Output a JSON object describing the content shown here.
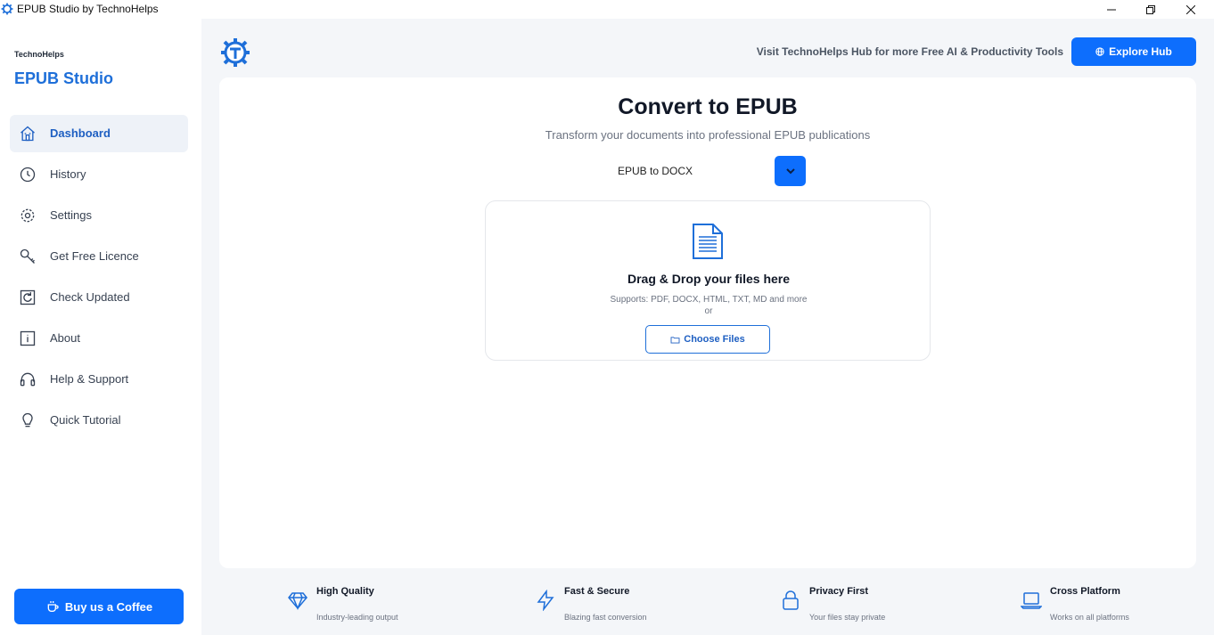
{
  "window": {
    "title": "EPUB Studio by TechnoHelps",
    "colors": {
      "accent": "#0d6efd",
      "brand_text": "#1e6fd9"
    }
  },
  "sidebar": {
    "brand_small": "TechnoHelps",
    "brand_big": "EPUB Studio",
    "items": [
      {
        "label": "Dashboard",
        "icon": "home-icon",
        "active": true
      },
      {
        "label": "History",
        "icon": "clock-icon"
      },
      {
        "label": "Settings",
        "icon": "gear-icon"
      },
      {
        "label": "Get Free Licence",
        "icon": "key-icon"
      },
      {
        "label": "Check Updated",
        "icon": "refresh-icon"
      },
      {
        "label": "About",
        "icon": "info-icon"
      },
      {
        "label": "Help & Support",
        "icon": "headset-icon"
      },
      {
        "label": "Quick Tutorial",
        "icon": "lightbulb-icon"
      }
    ],
    "coffee_label": "Buy us a Coffee"
  },
  "header": {
    "hub_text": "Visit TechnoHelps Hub for more Free AI & Productivity Tools",
    "hub_button": "Explore Hub"
  },
  "converter": {
    "title": "Convert to EPUB",
    "subtitle": "Transform your documents into professional EPUB publications",
    "selected_mode": "EPUB to DOCX",
    "dropzone": {
      "title": "Drag & Drop your files here",
      "supports": "Supports: PDF, DOCX, HTML, TXT, MD and more",
      "or": "or",
      "choose_label": "Choose Files"
    }
  },
  "features": [
    {
      "title": "High Quality",
      "desc": "Industry-leading output",
      "icon": "diamond-icon"
    },
    {
      "title": "Fast & Secure",
      "desc": "Blazing fast conversion",
      "icon": "bolt-icon"
    },
    {
      "title": "Privacy First",
      "desc": "Your files stay private",
      "icon": "lock-icon"
    },
    {
      "title": "Cross Platform",
      "desc": "Works on all platforms",
      "icon": "laptop-icon"
    }
  ]
}
